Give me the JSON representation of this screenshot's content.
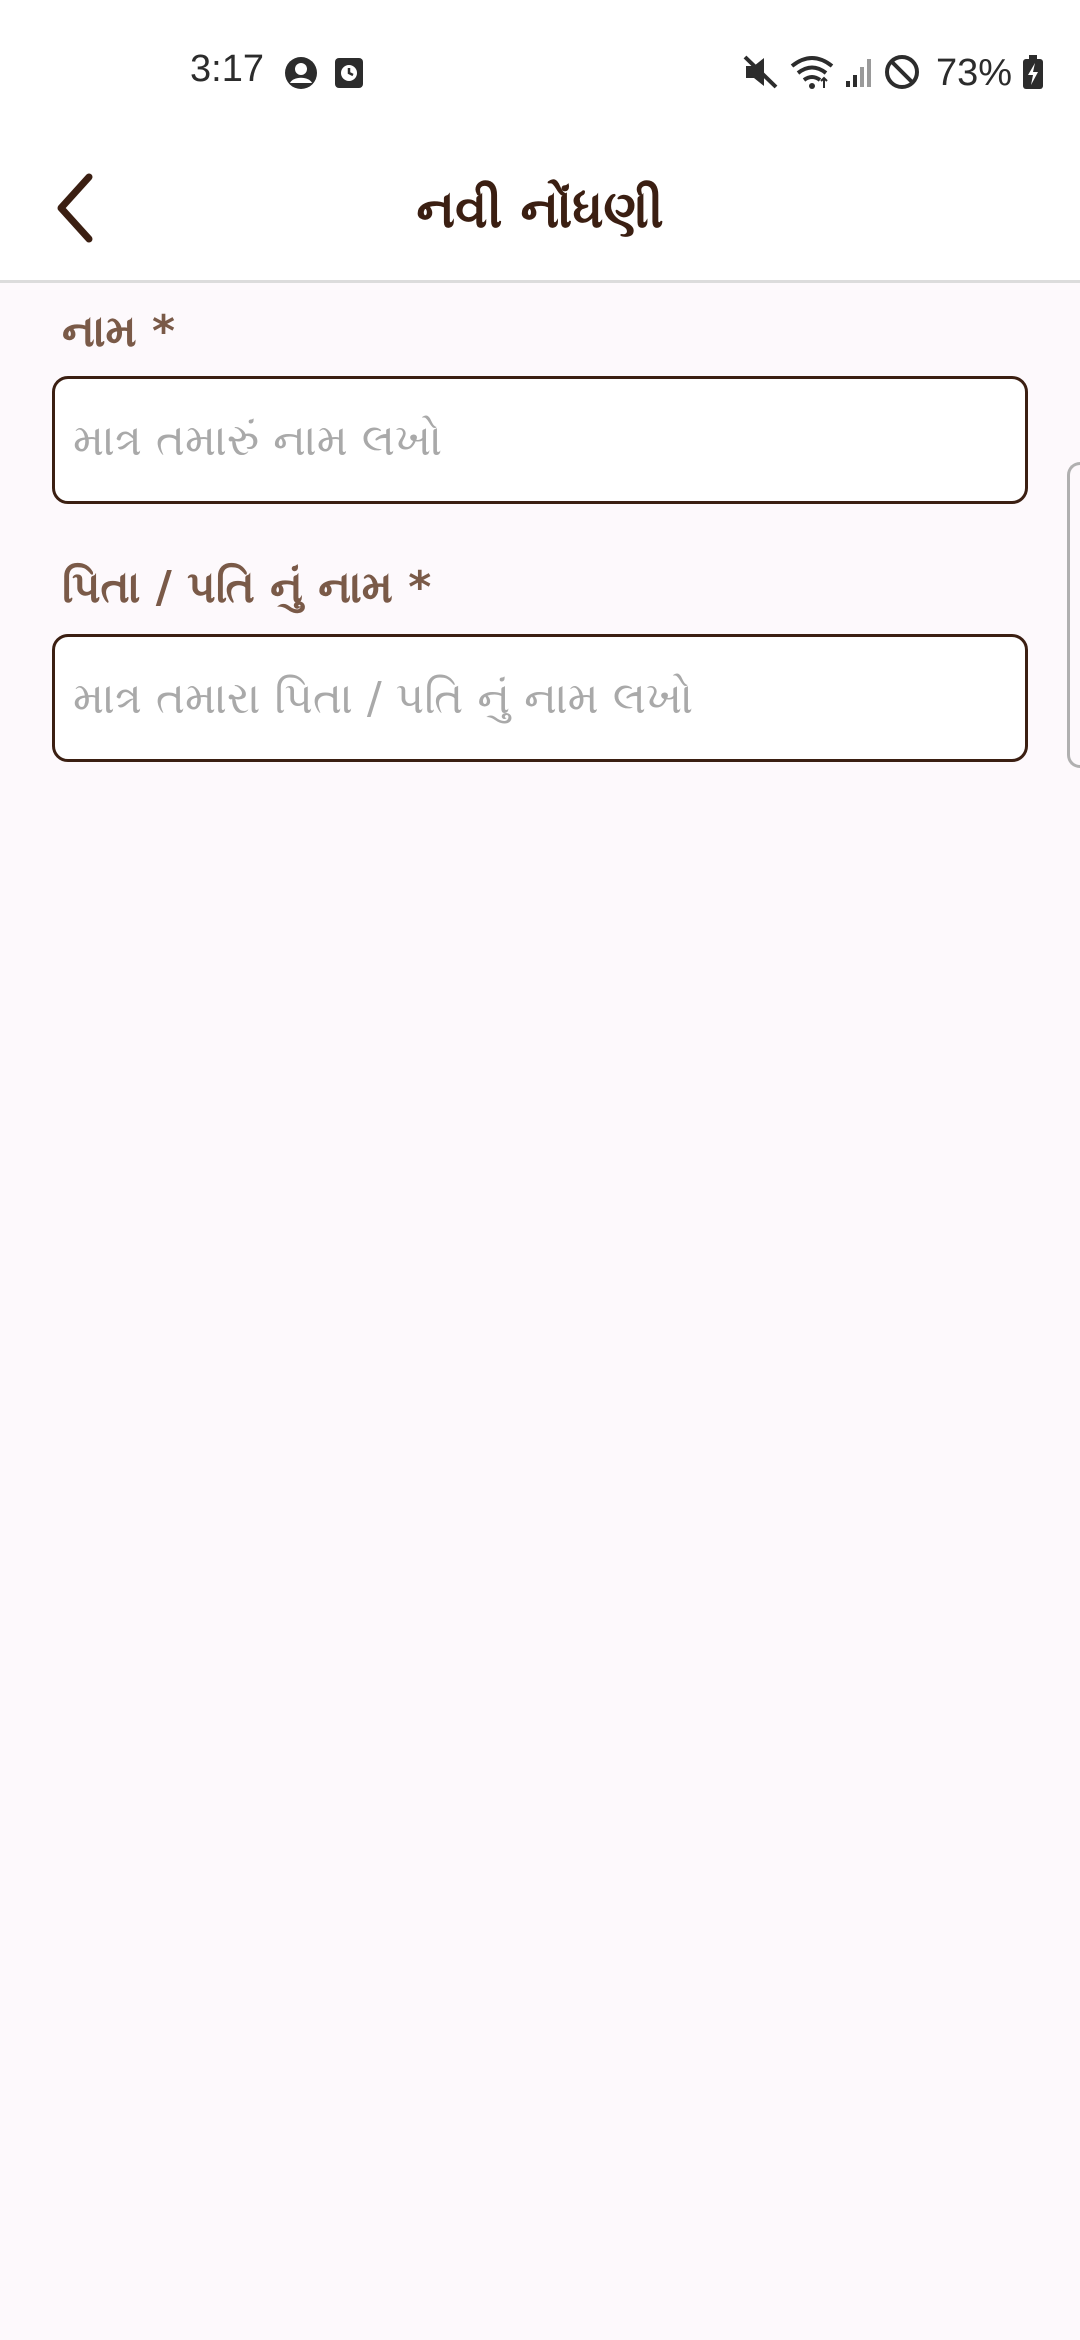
{
  "status_bar": {
    "time": "3:17",
    "battery": "73%",
    "icons_left": [
      "account-circle-icon",
      "clock-badge-icon"
    ],
    "icons_right": [
      "mute-icon",
      "wifi-icon",
      "signal-icon",
      "do-not-disturb-icon",
      "battery-charging-icon"
    ]
  },
  "app_bar": {
    "title": "નવી નોંધણી",
    "back_icon": "chevron-left-icon"
  },
  "form": {
    "name_label": "નામ *",
    "name_placeholder": "માત્ર તમારું નામ લખો",
    "name_value": "",
    "father_label": "પિતા / પતિ નું નામ *",
    "father_placeholder": "માત્ર તમારા પિતા / પતિ નું નામ લખો",
    "father_value": ""
  },
  "colors": {
    "accent": "#3b1f12",
    "label": "#7a5a48",
    "background": "#fdf9fc",
    "placeholder": "#a9a9a9"
  }
}
